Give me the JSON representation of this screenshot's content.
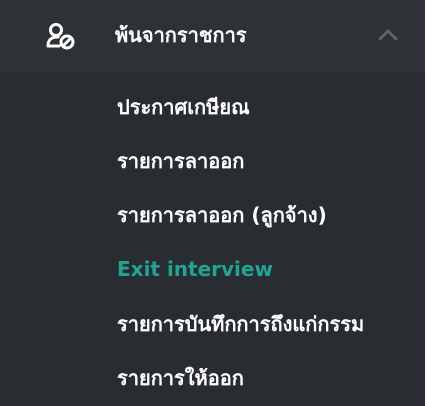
{
  "section": {
    "icon": "user-block-icon",
    "label": "พ้นจากราชการ",
    "expanded_icon": "chevron-up-icon"
  },
  "items": [
    {
      "label": "ประกาศเกษียณ",
      "active": false
    },
    {
      "label": "รายการลาออก",
      "active": false
    },
    {
      "label": "รายการลาออก (ลูกจ้าง)",
      "active": false
    },
    {
      "label": "Exit interview",
      "active": true
    },
    {
      "label": "รายการบันทึกการถึงแก่กรรม",
      "active": false
    },
    {
      "label": "รายการให้ออก",
      "active": false
    }
  ],
  "colors": {
    "background": "#2b2f33",
    "header_background": "#2e3236",
    "text": "#ffffff",
    "active_text": "#1fa594",
    "chevron": "#5f6368"
  }
}
